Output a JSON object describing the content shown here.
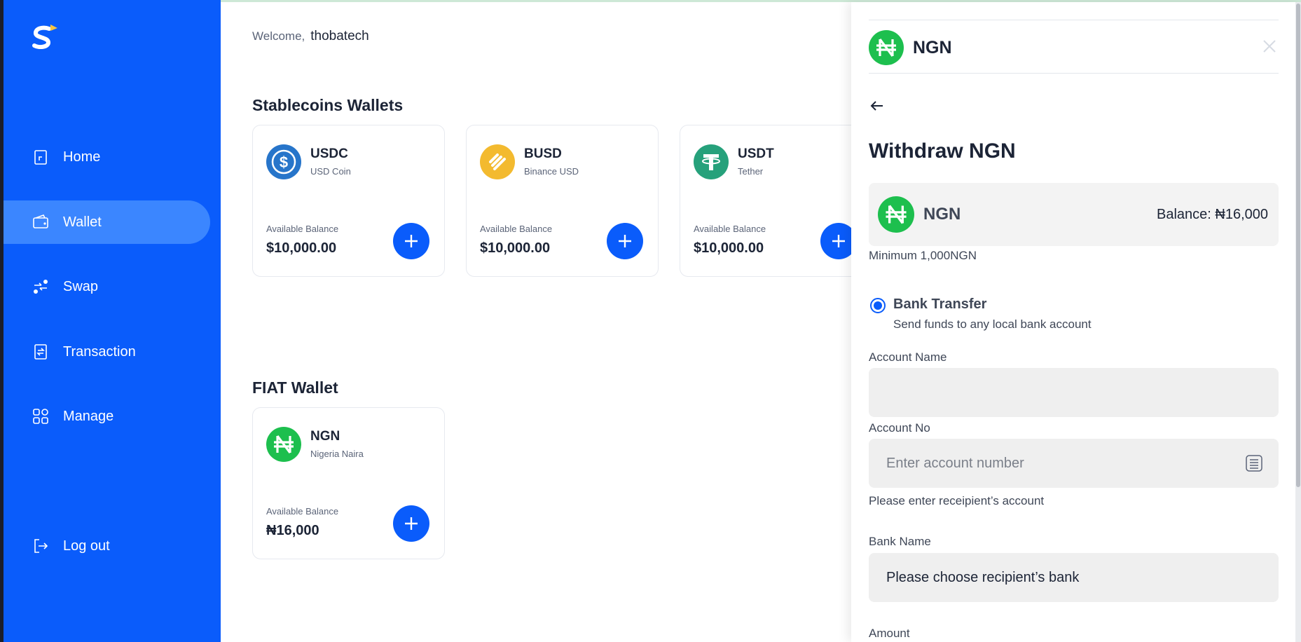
{
  "colors": {
    "brand_blue": "#0a5cfb",
    "active_nav": "#3b86ff",
    "naira_green": "#1dbf4e",
    "usdc_blue": "#2775ca",
    "busd_yellow": "#f3ba2f",
    "usdt_green": "#26a17b"
  },
  "sidebar": {
    "logo_icon": "s-logo-icon",
    "items": [
      {
        "label": "Home",
        "icon": "home-icon"
      },
      {
        "label": "Wallet",
        "icon": "wallet-icon",
        "active": true
      },
      {
        "label": "Swap",
        "icon": "swap-icon"
      },
      {
        "label": "Transaction",
        "icon": "transaction-icon"
      },
      {
        "label": "Manage",
        "icon": "manage-icon"
      }
    ],
    "logout": {
      "label": "Log out",
      "icon": "logout-icon"
    }
  },
  "header": {
    "welcome": "Welcome,",
    "username": "thobatech"
  },
  "stablecoins": {
    "title": "Stablecoins Wallets",
    "cards": [
      {
        "symbol": "USDC",
        "name": "USD Coin",
        "available_label": "Available Balance",
        "balance": "$10,000.00",
        "icon": "usdc-icon"
      },
      {
        "symbol": "BUSD",
        "name": "Binance USD",
        "available_label": "Available Balance",
        "balance": "$10,000.00",
        "icon": "busd-icon"
      },
      {
        "symbol": "USDT",
        "name": "Tether",
        "available_label": "Available Balance",
        "balance": "$10,000.00",
        "icon": "usdt-icon"
      }
    ]
  },
  "fiat": {
    "title": "FIAT Wallet",
    "cards": [
      {
        "symbol": "NGN",
        "name": "Nigeria Naira",
        "available_label": "Available Balance",
        "balance": "₦16,000",
        "icon": "naira-icon"
      }
    ]
  },
  "drawer": {
    "header_title": "NGN",
    "close_icon": "close-icon",
    "back_icon": "back-arrow-icon",
    "title": "Withdraw NGN",
    "balance_box": {
      "currency": "NGN",
      "balance": "Balance: ₦16,000"
    },
    "minimum": "Minimum 1,000NGN",
    "method": {
      "title": "Bank Transfer",
      "description": "Send funds to any local bank account",
      "selected": true
    },
    "account_name": {
      "label": "Account Name",
      "value": ""
    },
    "account_no": {
      "label": "Account No",
      "placeholder": "Enter account number",
      "helper": "Please enter receipient’s account"
    },
    "bank_name": {
      "label": "Bank Name",
      "value": "Please choose recipient’s bank"
    },
    "amount": {
      "label": "Amount"
    }
  }
}
